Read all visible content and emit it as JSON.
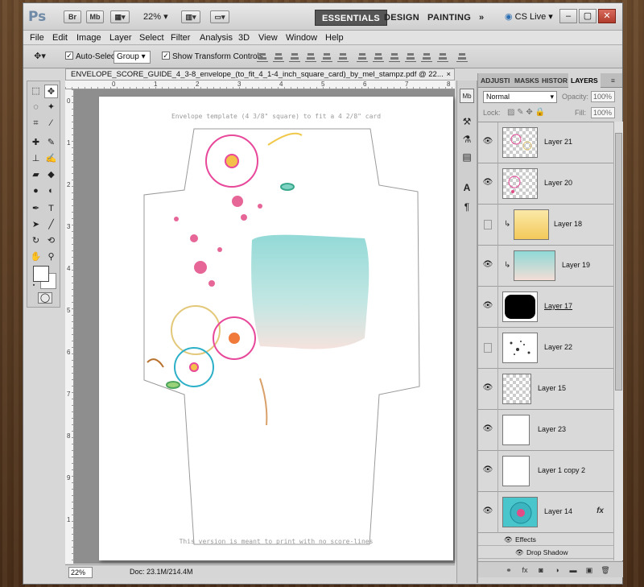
{
  "app": {
    "logo": "Ps",
    "bridge_label": "Br",
    "minibridge_label": "Mb",
    "zoom_level": "22%",
    "workspaces": [
      "ESSENTIALS",
      "DESIGN",
      "PAINTING"
    ],
    "more_workspaces": "»",
    "cs_live": "CS Live",
    "window_controls": [
      "–",
      "▢",
      "✕"
    ]
  },
  "menu": [
    "File",
    "Edit",
    "Image",
    "Layer",
    "Select",
    "Filter",
    "Analysis",
    "3D",
    "View",
    "Window",
    "Help"
  ],
  "options": {
    "auto_select_label": "Auto-Select:",
    "auto_select_checked": true,
    "auto_select_value": "Group",
    "transform_label": "Show Transform Controls",
    "transform_checked": true
  },
  "document": {
    "tab_title": "ENVELOPE_SCORE_GUIDE_4_3-8_envelope_(to_fit_4_1-4_inch_square_card)_by_mel_stampz.pdf @ 22...",
    "close": "×",
    "template_top_text": "Envelope template (4 3/8\" square) to fit a 4 2/8\" card",
    "template_bottom_text": "This version is meant to print with no score-lines",
    "ruler_top_numbers": [
      "0",
      "1",
      "2",
      "3",
      "4",
      "5",
      "6",
      "7",
      "8"
    ],
    "ruler_left_numbers": [
      "0",
      "1",
      "2",
      "3",
      "4",
      "5",
      "6",
      "7",
      "8",
      "9",
      "1"
    ]
  },
  "status": {
    "zoom": "22%",
    "doc_size": "Doc: 23.1M/214.4M"
  },
  "panel": {
    "tabs": [
      "ADJUSTI",
      "MASKS",
      "HISTOR",
      "LAYERS"
    ],
    "active_tab": "LAYERS",
    "blend_mode": "Normal",
    "opacity_label": "Opacity:",
    "opacity_value": "100%",
    "lock_label": "Lock:",
    "fill_label": "Fill:",
    "fill_value": "100%",
    "layers": [
      {
        "name": "Layer 21",
        "visible": true,
        "clipped": false,
        "thumb": "flowers"
      },
      {
        "name": "Layer 20",
        "visible": true,
        "clipped": false,
        "thumb": "flowers2"
      },
      {
        "name": "Layer 18",
        "visible": false,
        "clipped": true,
        "thumb": "yellow"
      },
      {
        "name": "Layer 19",
        "visible": true,
        "clipped": true,
        "thumb": "teal"
      },
      {
        "name": "Layer 17",
        "visible": true,
        "clipped": false,
        "thumb": "black"
      },
      {
        "name": "Layer 22",
        "visible": false,
        "clipped": false,
        "thumb": "splatter"
      },
      {
        "name": "Layer 15",
        "visible": true,
        "clipped": false,
        "thumb": "checker"
      },
      {
        "name": "Layer 23",
        "visible": true,
        "clipped": false,
        "thumb": "white"
      },
      {
        "name": "Layer 1 copy 2",
        "visible": true,
        "clipped": false,
        "thumb": "white"
      },
      {
        "name": "Layer 14",
        "visible": true,
        "clipped": false,
        "thumb": "flower-teal",
        "fx": "fx"
      }
    ],
    "effects_label": "Effects",
    "drop_shadow_label": "Drop Shadow"
  }
}
